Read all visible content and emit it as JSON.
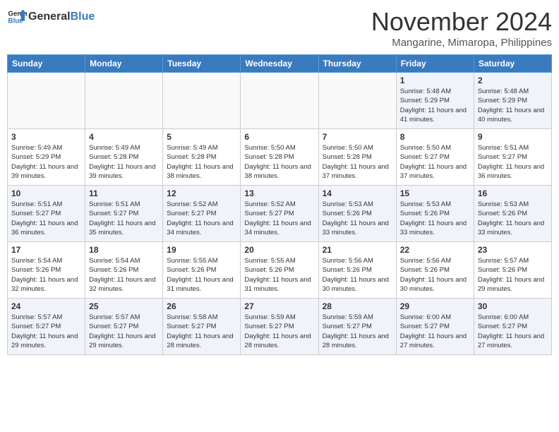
{
  "header": {
    "logo_general": "General",
    "logo_blue": "Blue",
    "month": "November 2024",
    "location": "Mangarine, Mimaropa, Philippines"
  },
  "weekdays": [
    "Sunday",
    "Monday",
    "Tuesday",
    "Wednesday",
    "Thursday",
    "Friday",
    "Saturday"
  ],
  "weeks": [
    [
      {
        "day": "",
        "info": ""
      },
      {
        "day": "",
        "info": ""
      },
      {
        "day": "",
        "info": ""
      },
      {
        "day": "",
        "info": ""
      },
      {
        "day": "",
        "info": ""
      },
      {
        "day": "1",
        "info": "Sunrise: 5:48 AM\nSunset: 5:29 PM\nDaylight: 11 hours and 41 minutes."
      },
      {
        "day": "2",
        "info": "Sunrise: 5:48 AM\nSunset: 5:29 PM\nDaylight: 11 hours and 40 minutes."
      }
    ],
    [
      {
        "day": "3",
        "info": "Sunrise: 5:49 AM\nSunset: 5:29 PM\nDaylight: 11 hours and 39 minutes."
      },
      {
        "day": "4",
        "info": "Sunrise: 5:49 AM\nSunset: 5:28 PM\nDaylight: 11 hours and 39 minutes."
      },
      {
        "day": "5",
        "info": "Sunrise: 5:49 AM\nSunset: 5:28 PM\nDaylight: 11 hours and 38 minutes."
      },
      {
        "day": "6",
        "info": "Sunrise: 5:50 AM\nSunset: 5:28 PM\nDaylight: 11 hours and 38 minutes."
      },
      {
        "day": "7",
        "info": "Sunrise: 5:50 AM\nSunset: 5:28 PM\nDaylight: 11 hours and 37 minutes."
      },
      {
        "day": "8",
        "info": "Sunrise: 5:50 AM\nSunset: 5:27 PM\nDaylight: 11 hours and 37 minutes."
      },
      {
        "day": "9",
        "info": "Sunrise: 5:51 AM\nSunset: 5:27 PM\nDaylight: 11 hours and 36 minutes."
      }
    ],
    [
      {
        "day": "10",
        "info": "Sunrise: 5:51 AM\nSunset: 5:27 PM\nDaylight: 11 hours and 36 minutes."
      },
      {
        "day": "11",
        "info": "Sunrise: 5:51 AM\nSunset: 5:27 PM\nDaylight: 11 hours and 35 minutes."
      },
      {
        "day": "12",
        "info": "Sunrise: 5:52 AM\nSunset: 5:27 PM\nDaylight: 11 hours and 34 minutes."
      },
      {
        "day": "13",
        "info": "Sunrise: 5:52 AM\nSunset: 5:27 PM\nDaylight: 11 hours and 34 minutes."
      },
      {
        "day": "14",
        "info": "Sunrise: 5:53 AM\nSunset: 5:26 PM\nDaylight: 11 hours and 33 minutes."
      },
      {
        "day": "15",
        "info": "Sunrise: 5:53 AM\nSunset: 5:26 PM\nDaylight: 11 hours and 33 minutes."
      },
      {
        "day": "16",
        "info": "Sunrise: 5:53 AM\nSunset: 5:26 PM\nDaylight: 11 hours and 33 minutes."
      }
    ],
    [
      {
        "day": "17",
        "info": "Sunrise: 5:54 AM\nSunset: 5:26 PM\nDaylight: 11 hours and 32 minutes."
      },
      {
        "day": "18",
        "info": "Sunrise: 5:54 AM\nSunset: 5:26 PM\nDaylight: 11 hours and 32 minutes."
      },
      {
        "day": "19",
        "info": "Sunrise: 5:55 AM\nSunset: 5:26 PM\nDaylight: 11 hours and 31 minutes."
      },
      {
        "day": "20",
        "info": "Sunrise: 5:55 AM\nSunset: 5:26 PM\nDaylight: 11 hours and 31 minutes."
      },
      {
        "day": "21",
        "info": "Sunrise: 5:56 AM\nSunset: 5:26 PM\nDaylight: 11 hours and 30 minutes."
      },
      {
        "day": "22",
        "info": "Sunrise: 5:56 AM\nSunset: 5:26 PM\nDaylight: 11 hours and 30 minutes."
      },
      {
        "day": "23",
        "info": "Sunrise: 5:57 AM\nSunset: 5:26 PM\nDaylight: 11 hours and 29 minutes."
      }
    ],
    [
      {
        "day": "24",
        "info": "Sunrise: 5:57 AM\nSunset: 5:27 PM\nDaylight: 11 hours and 29 minutes."
      },
      {
        "day": "25",
        "info": "Sunrise: 5:57 AM\nSunset: 5:27 PM\nDaylight: 11 hours and 29 minutes."
      },
      {
        "day": "26",
        "info": "Sunrise: 5:58 AM\nSunset: 5:27 PM\nDaylight: 11 hours and 28 minutes."
      },
      {
        "day": "27",
        "info": "Sunrise: 5:59 AM\nSunset: 5:27 PM\nDaylight: 11 hours and 28 minutes."
      },
      {
        "day": "28",
        "info": "Sunrise: 5:59 AM\nSunset: 5:27 PM\nDaylight: 11 hours and 28 minutes."
      },
      {
        "day": "29",
        "info": "Sunrise: 6:00 AM\nSunset: 5:27 PM\nDaylight: 11 hours and 27 minutes."
      },
      {
        "day": "30",
        "info": "Sunrise: 6:00 AM\nSunset: 5:27 PM\nDaylight: 11 hours and 27 minutes."
      }
    ]
  ]
}
